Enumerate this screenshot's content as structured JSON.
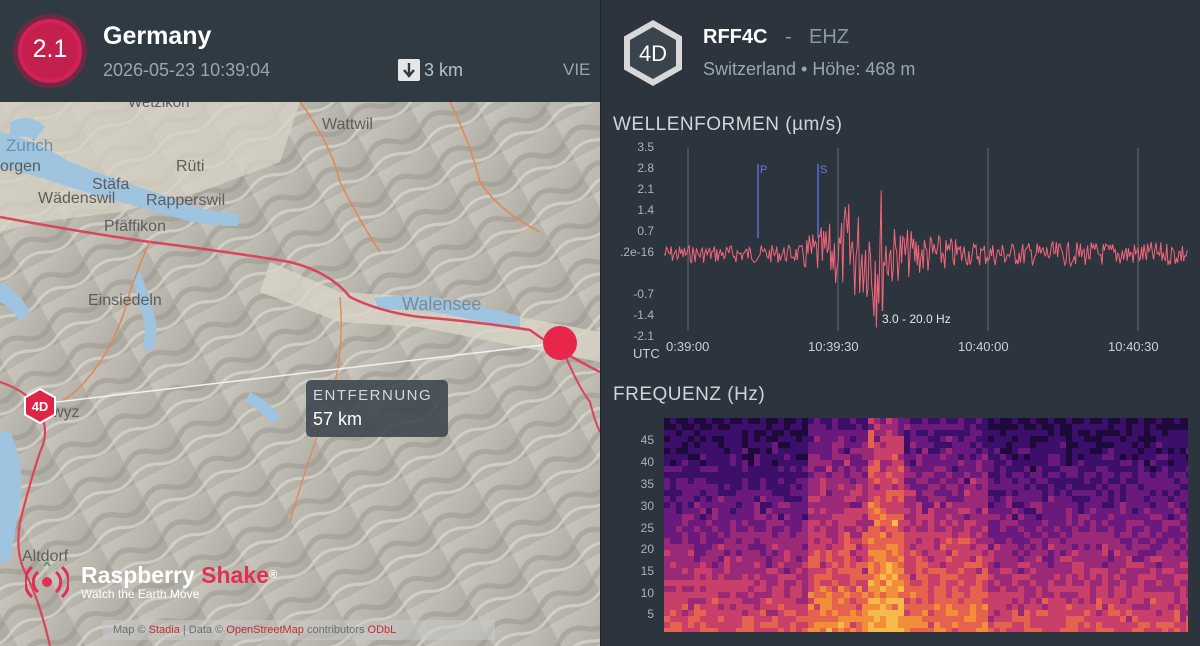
{
  "event": {
    "magnitude": "2.1",
    "region": "Germany",
    "datetime": "2026-05-23 10:39:04",
    "depth": "3 km",
    "source": "VIE",
    "colors": {
      "magnitude": "#d5205a",
      "epicenter": "#e8254a"
    }
  },
  "map": {
    "labels": [
      "Wetzikon",
      "Wattwil",
      "Zurich",
      "orgen",
      "Rüti",
      "Stäfa",
      "Rapperswil",
      "Wädenswil",
      "Pfäffikon",
      "Einsiedeln",
      "Walensee",
      "wyz",
      "Altdorf"
    ],
    "distance_label": "ENTFERNUNG",
    "distance_value": "57 km",
    "station_marker": "4D",
    "attribution": {
      "map_prefix": "Map ©",
      "map_link": "Stadia",
      "data_prefix": "| Data ©",
      "data_link": "OpenStreetMap",
      "suffix": "contributors",
      "extra": "ODbL"
    }
  },
  "brand": {
    "name_a": "Raspberry",
    "name_b": "Shake",
    "reg": "®",
    "tagline": "Watch the Earth Move"
  },
  "station": {
    "network": "4D",
    "code": "RFF4C",
    "separator": "-",
    "channel": "EHZ",
    "location": "Switzerland • Höhe: 468 m"
  },
  "waveform": {
    "title": "WELLENFORMEN (µm/s)",
    "y_ticks": [
      "3.5",
      "2.8",
      "2.1",
      "1.4",
      "0.7",
      ".2e-16",
      "-0.7",
      "-1.4",
      "-2.1"
    ],
    "x_axis_label": "UTC",
    "x_ticks": [
      "0:39:00",
      "10:39:30",
      "10:40:00",
      "10:40:30"
    ],
    "picks": [
      "P",
      "S"
    ],
    "filter": "3.0 - 20.0 Hz",
    "trace_color": "#f2657a"
  },
  "spectrogram": {
    "title": "FREQUENZ (Hz)",
    "y_ticks": [
      "45",
      "40",
      "35",
      "30",
      "25",
      "20",
      "15",
      "10",
      "5"
    ]
  }
}
